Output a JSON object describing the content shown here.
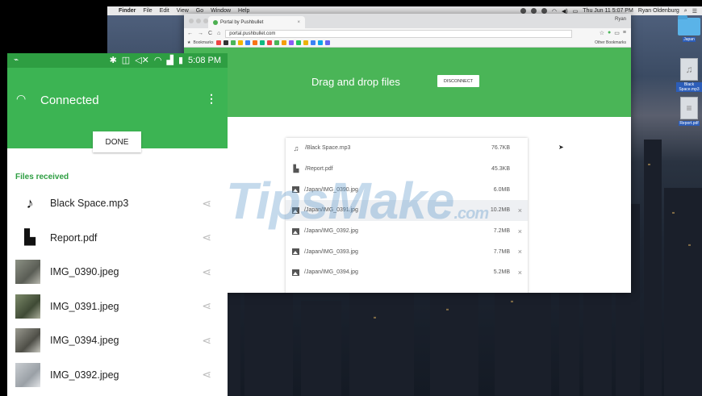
{
  "menubar": {
    "app": "Finder",
    "menus": [
      "File",
      "Edit",
      "View",
      "Go",
      "Window",
      "Help"
    ],
    "clock": "Thu Jun 11  5:07 PM",
    "user": "Ryan Oldenburg"
  },
  "desktop_icons": [
    {
      "label": "Japan",
      "icon": "folder-icon"
    },
    {
      "label": "Black Space.mp3",
      "icon": "audio-file-icon"
    },
    {
      "label": "Report.pdf",
      "icon": "pdf-file-icon"
    }
  ],
  "browser": {
    "tab_title": "Portal by Pushbullet",
    "profile": "Ryan",
    "url": "portal.pushbullet.com",
    "bookmarks_label": "Bookmarks",
    "other_bookmarks": "Other Bookmarks",
    "header_title": "Drag and drop files",
    "disconnect_label": "DISCONNECT",
    "files": [
      {
        "path": "/Black Space.mp3",
        "size": "76.7KB",
        "icon": "music-note-icon"
      },
      {
        "path": "/Report.pdf",
        "size": "45.3KB",
        "icon": "document-icon"
      },
      {
        "path": "/Japan/IMG_0390.jpg",
        "size": "6.0MB",
        "icon": "image-icon"
      },
      {
        "path": "/Japan/IMG_0391.jpg",
        "size": "10.2MB",
        "icon": "image-icon"
      },
      {
        "path": "/Japan/IMG_0392.jpg",
        "size": "7.2MB",
        "icon": "image-icon"
      },
      {
        "path": "/Japan/IMG_0393.jpg",
        "size": "7.7MB",
        "icon": "image-icon"
      },
      {
        "path": "/Japan/IMG_0394.jpg",
        "size": "5.2MB",
        "icon": "image-icon"
      }
    ]
  },
  "watermark": {
    "main": "TipsMake",
    "suffix": ".com"
  },
  "phone": {
    "time": "5:08 PM",
    "title": "Connected",
    "done_label": "DONE",
    "section_label": "Files received",
    "files": [
      {
        "name": "Black Space.mp3",
        "icon": "music-note-icon"
      },
      {
        "name": "Report.pdf",
        "icon": "document-icon"
      },
      {
        "name": "IMG_0390.jpeg",
        "icon": "image-thumbnail"
      },
      {
        "name": "IMG_0391.jpeg",
        "icon": "image-thumbnail"
      },
      {
        "name": "IMG_0394.jpeg",
        "icon": "image-thumbnail"
      },
      {
        "name": "IMG_0392.jpeg",
        "icon": "image-thumbnail"
      }
    ]
  },
  "colors": {
    "pushbullet_green": "#4ab557",
    "android_green": "#3cb453",
    "status_green": "#2e9e42"
  }
}
